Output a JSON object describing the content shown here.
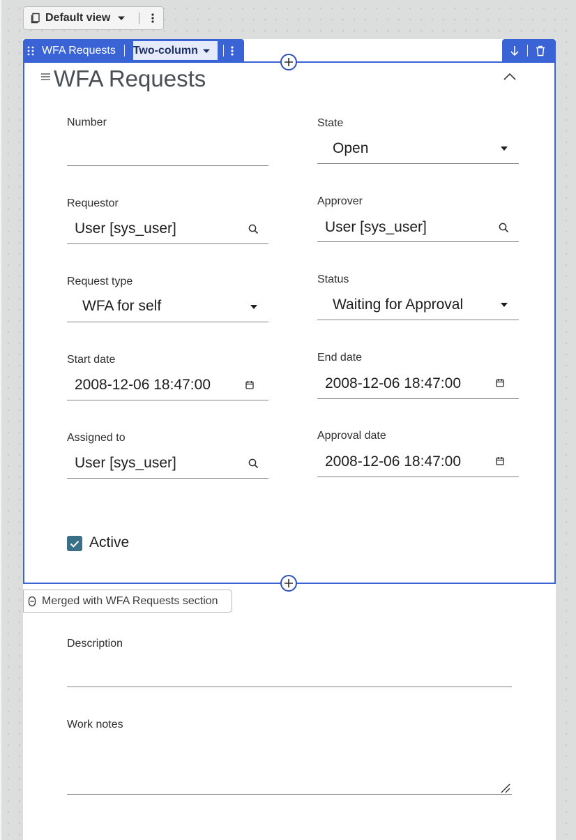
{
  "view_selector": {
    "label": "Default view"
  },
  "section_toolbar": {
    "title": "WFA Requests",
    "layout": "Two-column"
  },
  "section": {
    "title": "WFA Requests",
    "fields": {
      "number": {
        "label": "Number",
        "value": ""
      },
      "state": {
        "label": "State",
        "value": "Open"
      },
      "requestor": {
        "label": "Requestor",
        "value": "User [sys_user]"
      },
      "approver": {
        "label": "Approver",
        "value": "User [sys_user]"
      },
      "request_type": {
        "label": "Request type",
        "value": "WFA for self"
      },
      "status": {
        "label": "Status",
        "value": "Waiting for Approval"
      },
      "start_date": {
        "label": "Start date",
        "value": "2008-12-06 18:47:00"
      },
      "end_date": {
        "label": "End date",
        "value": "2008-12-06 18:47:00"
      },
      "assigned_to": {
        "label": "Assigned to",
        "value": "User [sys_user]"
      },
      "approval_date": {
        "label": "Approval date",
        "value": "2008-12-06 18:47:00"
      }
    },
    "active": {
      "label": "Active",
      "checked": true
    }
  },
  "merged_section": {
    "tag": "Merged with WFA Requests section",
    "fields": {
      "description": {
        "label": "Description",
        "value": ""
      },
      "work_notes": {
        "label": "Work notes",
        "value": ""
      }
    }
  },
  "colors": {
    "accent": "#3a63d6",
    "checkbox": "#3a6f88",
    "canvas": "#dcdddd"
  }
}
